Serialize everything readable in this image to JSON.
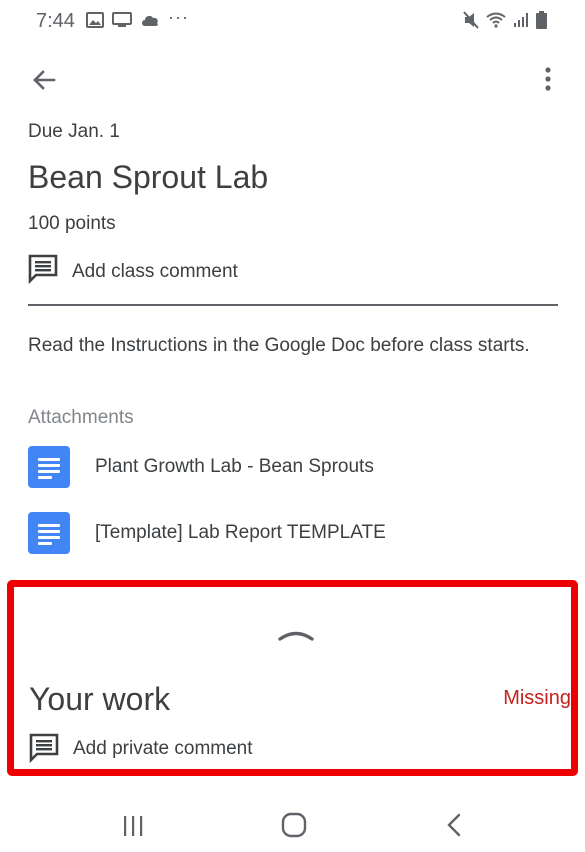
{
  "status_bar": {
    "time": "7:44",
    "dots": "···",
    "left_icons": [
      "gallery-icon",
      "cast-icon",
      "cloud-icon"
    ],
    "right_icons": [
      "mute-icon",
      "wifi-icon",
      "signal-icon",
      "battery-icon"
    ]
  },
  "top_bar": {
    "back_icon": "arrow-back-icon",
    "menu_icon": "more-vert-icon"
  },
  "assignment": {
    "due": "Due Jan. 1",
    "title": "Bean Sprout Lab",
    "points": "100 points",
    "class_comment_label": "Add class comment",
    "instructions": "Read the Instructions in the Google Doc before class starts.",
    "attachments_heading": "Attachments",
    "attachments": [
      {
        "label": "Plant Growth Lab - Bean Sprouts",
        "icon": "google-doc-icon"
      },
      {
        "label": "[Template] Lab Report TEMPLATE",
        "icon": "google-doc-icon"
      }
    ]
  },
  "your_work": {
    "title": "Your work",
    "status": "Missing",
    "private_comment_label": "Add private comment",
    "highlight_color": "#ee0000",
    "status_color": "#c5221f"
  },
  "nav_bar": {
    "icons": [
      "recent-apps-icon",
      "home-icon",
      "back-icon"
    ]
  },
  "colors": {
    "doc_blue": "#4285f4",
    "text": "#3c4043",
    "muted": "#80868b"
  }
}
